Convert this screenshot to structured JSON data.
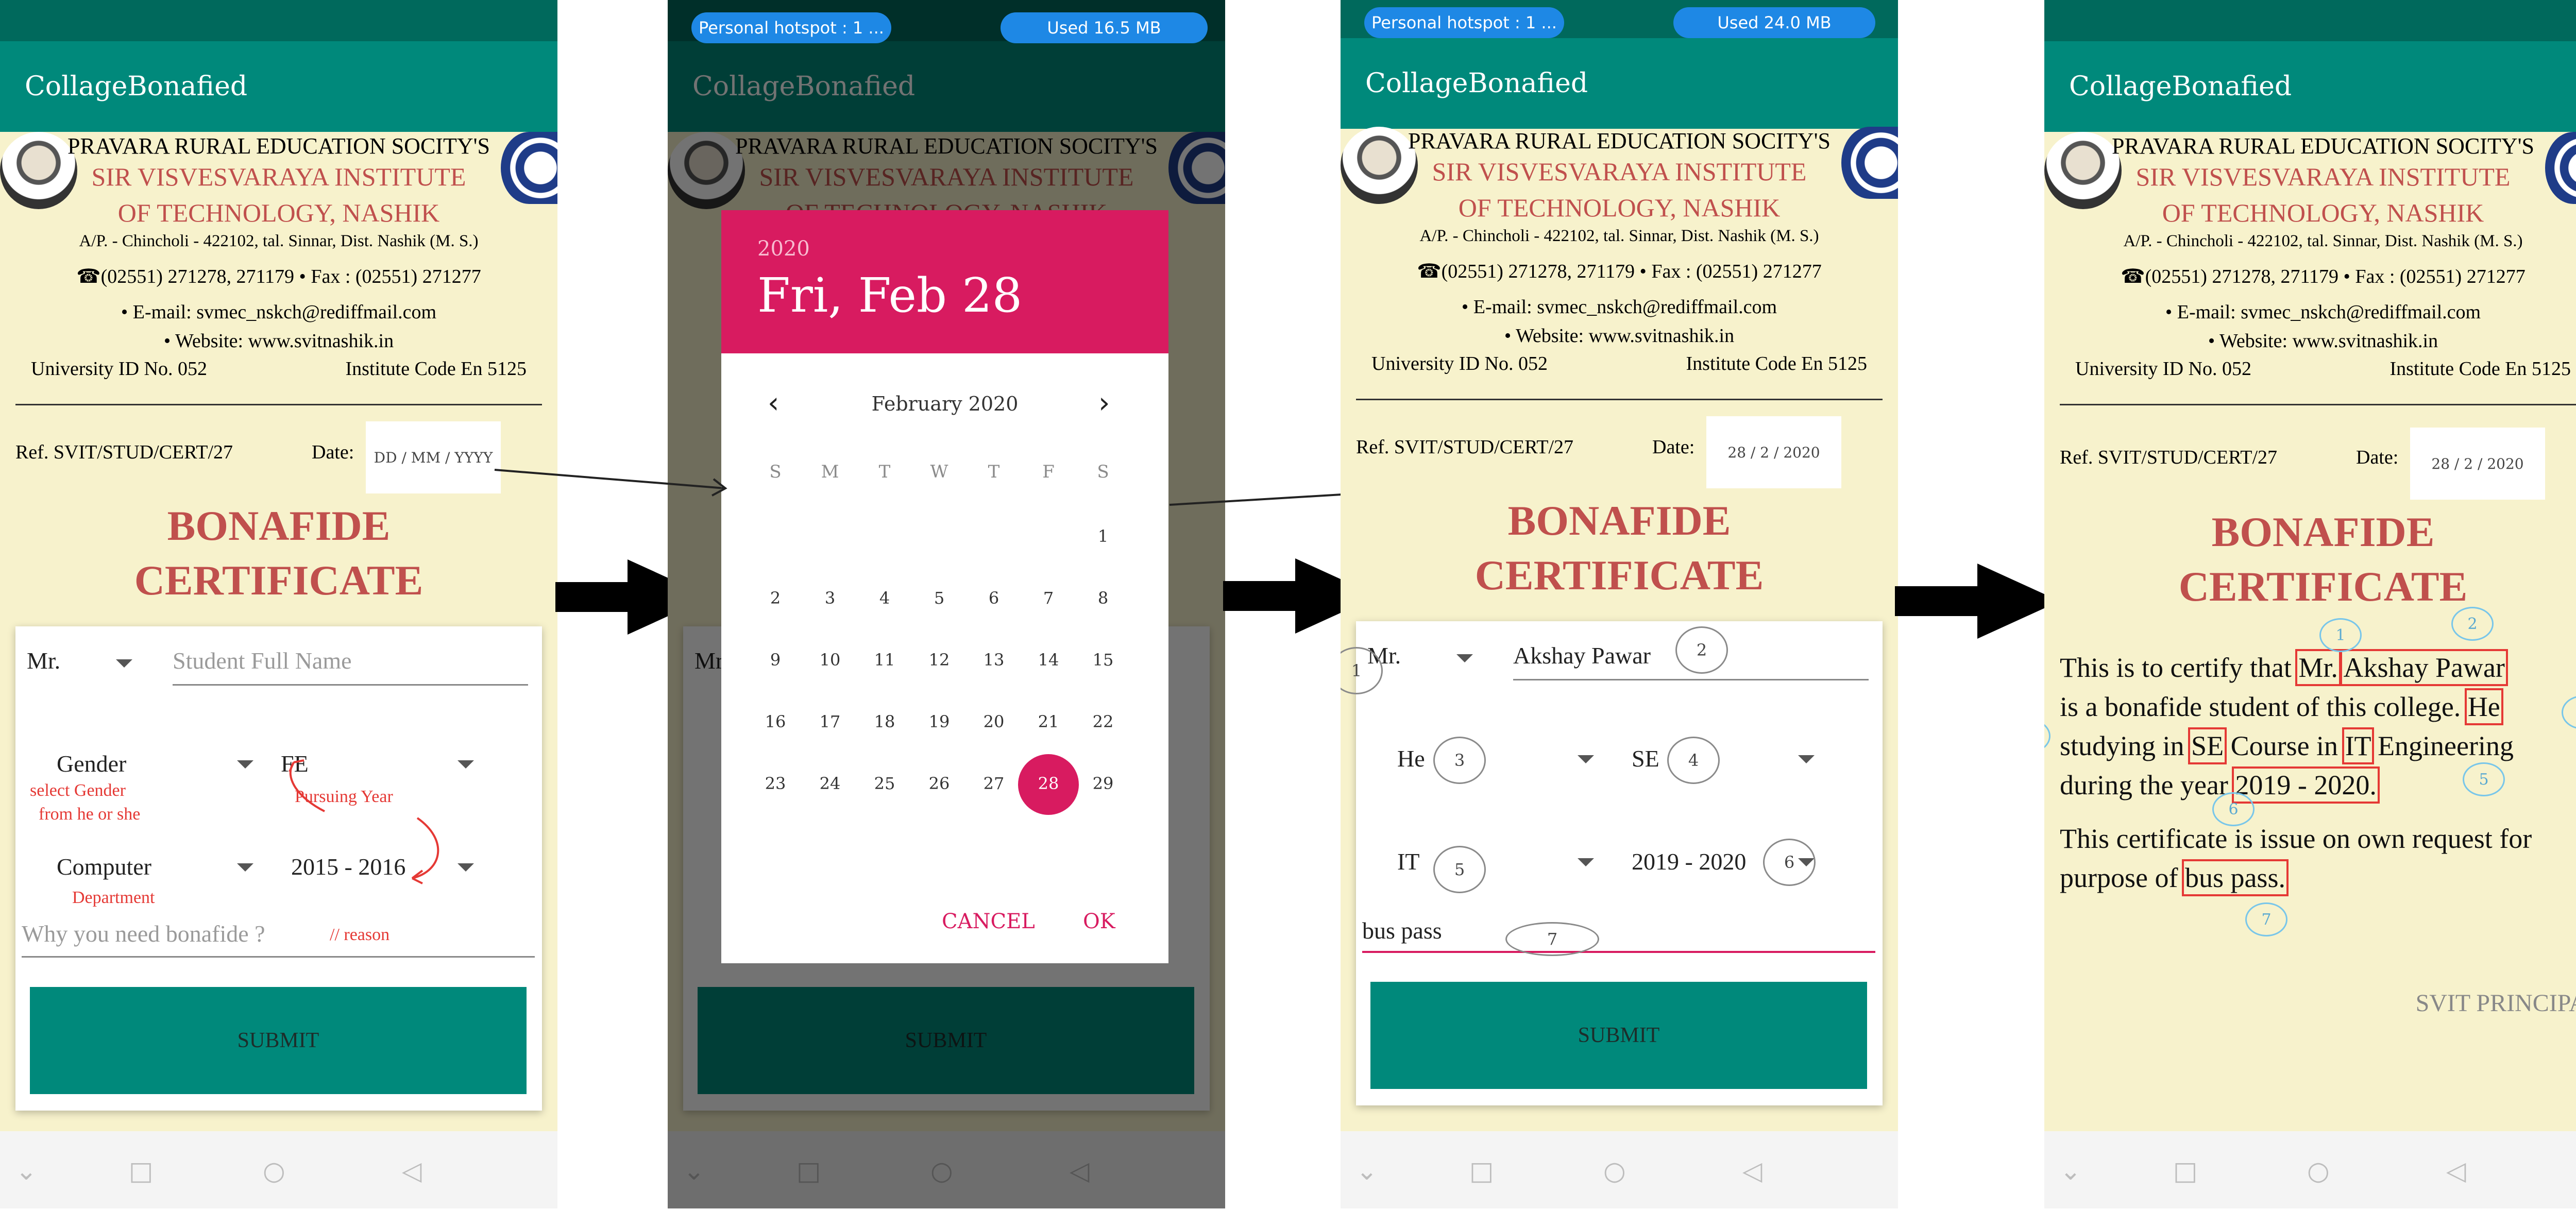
{
  "app": {
    "title": "CollageBonafied"
  },
  "header": {
    "society": "PRAVARA RURAL EDUCATION SOCITY'S",
    "institute_line1": "SIR VISVESVARAYA INSTITUTE",
    "institute_line2": "OF TECHNOLOGY, NASHIK",
    "address": "A/P. - Chincholi - 422102, tal. Sinnar, Dist. Nashik (M. S.)",
    "phone": "☎(02551) 271278, 271179   • Fax : (02551) 271277",
    "email": "• E-mail: svmec_nskch@rediffmail.com",
    "website": "• Website: www.svitnashik.in",
    "university_id": "University ID No. 052",
    "institute_code": "Institute Code En 5125"
  },
  "form": {
    "ref": "Ref. SVIT/STUD/CERT/27",
    "date_label": "Date:",
    "date_placeholder": "DD / MM / YYYY",
    "date_value": "28 / 2 / 2020",
    "heading_line1": "BONAFIDE",
    "heading_line2": "CERTIFICATE",
    "salutation": "Mr.",
    "name_placeholder": "Student Full Name",
    "name_value": "Akshay Pawar",
    "gender_placeholder": "Gender",
    "gender_value": "He",
    "year_value_fe": "FE",
    "year_value_se": "SE",
    "department_placeholder": "Computer",
    "department_value": "IT",
    "academic_year_1": "2015 - 2016",
    "academic_year_2": "2019 - 2020",
    "reason_placeholder": "Why you need bonafide ?",
    "reason_value": "bus pass",
    "submit": "SUBMIT"
  },
  "notes": {
    "select_gender": "select Gender",
    "from_he_she": "from he or she",
    "pursuing_year": "Pursuing Year",
    "department": "Department",
    "reason": "// reason"
  },
  "status": {
    "hotspot": "Personal hotspot : 1 ...",
    "used_1": "Used  16.5 MB",
    "used_2": "Used  24.0 MB"
  },
  "datepicker": {
    "year": "2020",
    "date_title": "Fri, Feb 28",
    "month": "February 2020",
    "weekdays": [
      "S",
      "M",
      "T",
      "W",
      "T",
      "F",
      "S"
    ],
    "selected_day": 28,
    "cancel": "CANCEL",
    "ok": "OK"
  },
  "certificate": {
    "line1a": "This is to certify that",
    "salutation": "Mr.",
    "name": "Akshay Pawar",
    "line2a": "is a bonafide student of this college.",
    "pronoun": "He",
    "line3a": "studying in",
    "year": "SE",
    "line3b": "Course in",
    "department": "IT",
    "line3c": "Engineering",
    "line4a": "during the year",
    "academic_year": "2019 - 2020.",
    "line5": "This certificate is issue on own request for",
    "line6a": "purpose of",
    "purpose": "bus pass.",
    "signature": "SVIT PRINCIPAL"
  },
  "annotations": [
    "1",
    "2",
    "3",
    "4",
    "5",
    "6",
    "7"
  ],
  "colors": {
    "teal": "#00897b",
    "dark_teal": "#00695c",
    "cream": "#f7f2cc",
    "heading_red": "#c0504d",
    "pink": "#d81b60",
    "note_red": "#e53935",
    "hotspot_blue": "#1e88e5"
  }
}
